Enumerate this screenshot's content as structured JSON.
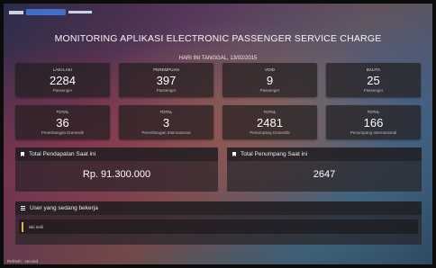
{
  "header": {
    "title": "MONITORING APLIKASI ELECTRONIC PASSENGER SERVICE CHARGE",
    "date_line": "HARI INI TANGGAL, 13/02/2015"
  },
  "stats_row1": [
    {
      "label": "LAKI-LAKI",
      "value": "2284",
      "sub": "Passenger"
    },
    {
      "label": "PEREMPUAN",
      "value": "397",
      "sub": "Passenger"
    },
    {
      "label": "VOID",
      "value": "9",
      "sub": "Passenger"
    },
    {
      "label": "BALITA",
      "value": "25",
      "sub": "Passenger"
    }
  ],
  "stats_row2": [
    {
      "label": "TOTAL",
      "value": "36",
      "sub": "Penerbangan Domestik"
    },
    {
      "label": "TOTAL",
      "value": "3",
      "sub": "Penerbangan Internasional"
    },
    {
      "label": "TOTAL",
      "value": "2481",
      "sub": "Penumpang Domestik"
    },
    {
      "label": "TOTAL",
      "value": "166",
      "sub": "Penumpang Internasional"
    }
  ],
  "income_panel": {
    "title": "Total Pendapatan Saat ini",
    "value": "Rp. 91.300.000"
  },
  "passenger_panel": {
    "title": "Total Penumpang Saat ini",
    "value": "2647"
  },
  "users_panel": {
    "title": "User yang sedang bekerja",
    "users": [
      "iski nelli"
    ]
  },
  "footer": {
    "refresh": "Refresh : second"
  }
}
